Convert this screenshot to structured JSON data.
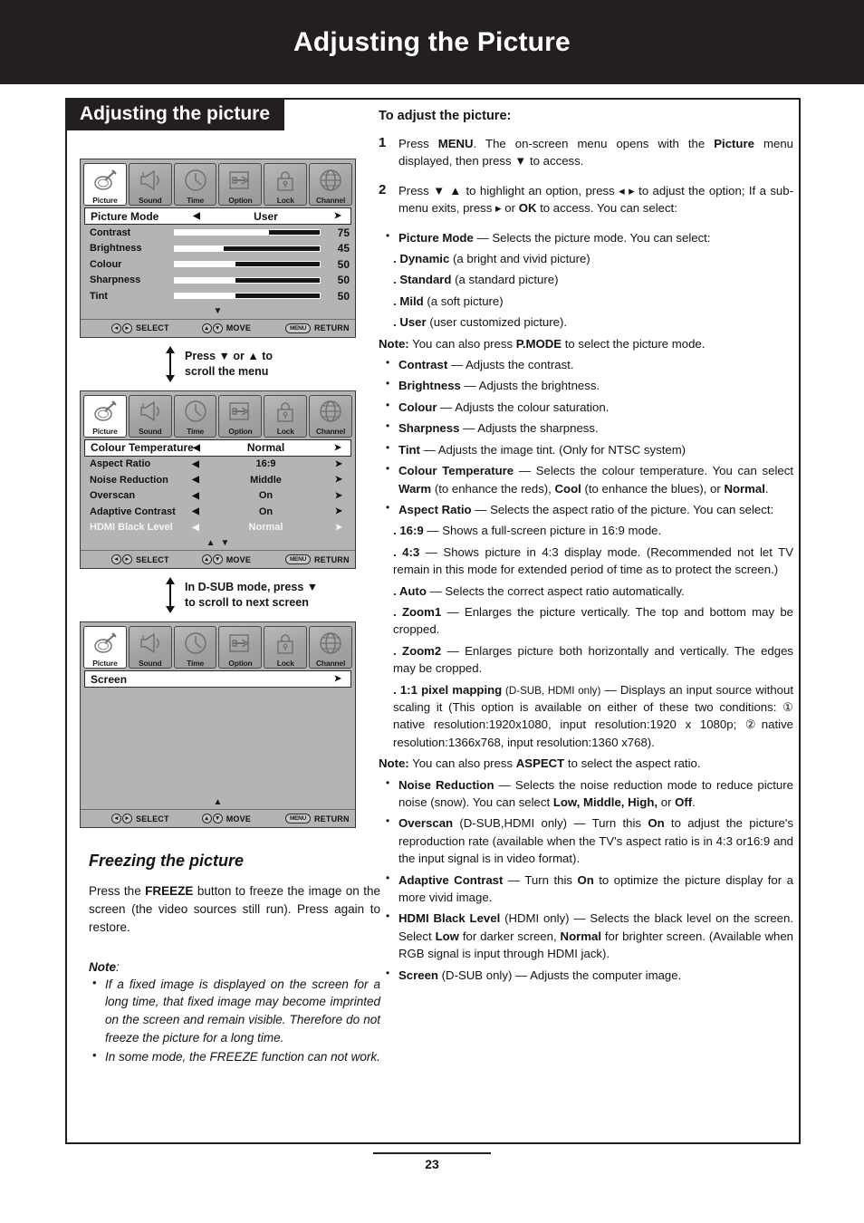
{
  "header": {
    "title": "Adjusting the Picture"
  },
  "section": {
    "tab_label": "Adjusting the picture"
  },
  "osd": {
    "tabs": [
      {
        "label": "Picture",
        "icon": "picture-icon",
        "active": true
      },
      {
        "label": "Sound",
        "icon": "speaker-icon",
        "active": false
      },
      {
        "label": "Time",
        "icon": "clock-icon",
        "active": false
      },
      {
        "label": "Option",
        "icon": "option-tool-icon",
        "active": false
      },
      {
        "label": "Lock",
        "icon": "padlock-icon",
        "active": false
      },
      {
        "label": "Channel",
        "icon": "globe-icon",
        "active": false
      }
    ],
    "footer": {
      "select": "SELECT",
      "move": "MOVE",
      "return": "RETURN",
      "menu_key": "MENU"
    },
    "panel1": {
      "highlight": {
        "label": "Picture Mode",
        "value": "User",
        "arrow_left": "◀",
        "arrow_right": "➤"
      },
      "sliders": [
        {
          "label": "Contrast",
          "value": "75",
          "fill_pct": 35
        },
        {
          "label": "Brightness",
          "value": "45",
          "fill_pct": 66
        },
        {
          "label": "Colour",
          "value": "50",
          "fill_pct": 58
        },
        {
          "label": "Sharpness",
          "value": "50",
          "fill_pct": 58
        },
        {
          "label": "Tint",
          "value": "50",
          "fill_pct": 58
        }
      ],
      "scroll_hint": "▼"
    },
    "panel2": {
      "highlight": {
        "label": "Colour Temperature",
        "value": "Normal"
      },
      "rows": [
        {
          "label": "Aspect Ratio",
          "value": "16:9",
          "dim": false
        },
        {
          "label": "Noise Reduction",
          "value": "Middle",
          "dim": false
        },
        {
          "label": "Overscan",
          "value": "On",
          "dim": false
        },
        {
          "label": "Adaptive Contrast",
          "value": "On",
          "dim": false
        },
        {
          "label": "HDMI Black Level",
          "value": "Normal",
          "dim": true
        }
      ],
      "scroll_hint_up": "▲",
      "scroll_hint_down": "▼"
    },
    "panel3": {
      "highlight": {
        "label": "Screen",
        "value": "",
        "arrow_right": "➤"
      },
      "scroll_hint_up": "▲"
    }
  },
  "between1": {
    "line1": "Press ▼  or ▲ to",
    "line2": "scroll the menu"
  },
  "between2": {
    "line1": "In D-SUB mode, press ▼",
    "line2": "to scroll to next screen"
  },
  "freeze": {
    "title": "Freezing the picture",
    "para_1a": "Press the ",
    "para_1b": "FREEZE",
    "para_1c": " button to freeze the image on the screen (the video sources still run). Press again to restore.",
    "note_label": "Note",
    "note_colon": ":",
    "notes": [
      "If a fixed image is displayed on the screen for a long time, that fixed image may become imprinted on the screen and remain visible. Therefore do not freeze the picture for a long time.",
      "In some mode, the FREEZE function can not work."
    ]
  },
  "right": {
    "title": "To adjust the picture:",
    "steps": [
      {
        "num": "1",
        "parts": [
          {
            "t": "Press ",
            "b": false
          },
          {
            "t": "MENU",
            "b": true
          },
          {
            "t": ". The on-screen menu opens with the ",
            "b": false
          },
          {
            "t": "Picture",
            "b": true
          },
          {
            "t": " menu displayed, then press ▼ to access.",
            "b": false
          }
        ]
      },
      {
        "num": "2",
        "parts": [
          {
            "t": "Press ▼ ▲ to highlight an option, press ◂  ▸ to adjust the option; If a sub-menu exits, press ▸ or ",
            "b": false
          },
          {
            "t": "OK",
            "b": true
          },
          {
            "t": " to access. You can select:",
            "b": false
          }
        ]
      }
    ],
    "items": [
      {
        "type": "bullet",
        "parts": [
          {
            "t": "Picture Mode",
            "b": true
          },
          {
            "t": " — Selects the picture mode. You can select:",
            "b": false
          }
        ]
      },
      {
        "type": "sub",
        "parts": [
          {
            "t": "Dynamic",
            "b": true
          },
          {
            "t": " (a bright and vivid picture)",
            "b": false
          }
        ]
      },
      {
        "type": "sub",
        "parts": [
          {
            "t": "Standard",
            "b": true
          },
          {
            "t": " (a standard picture)",
            "b": false
          }
        ]
      },
      {
        "type": "sub",
        "parts": [
          {
            "t": "Mild",
            "b": true
          },
          {
            "t": " (a soft picture)",
            "b": false
          }
        ]
      },
      {
        "type": "sub",
        "parts": [
          {
            "t": "User",
            "b": true
          },
          {
            "t": " (user customized picture).",
            "b": false
          }
        ]
      },
      {
        "type": "note",
        "parts": [
          {
            "t": "Note:",
            "b": true
          },
          {
            "t": " You can also press ",
            "b": false
          },
          {
            "t": "P.MODE",
            "b": true
          },
          {
            "t": " to select the picture mode.",
            "b": false
          }
        ]
      },
      {
        "type": "bullet",
        "parts": [
          {
            "t": "Contrast",
            "b": true
          },
          {
            "t": " — Adjusts the contrast.",
            "b": false
          }
        ]
      },
      {
        "type": "bullet",
        "parts": [
          {
            "t": "Brightness",
            "b": true
          },
          {
            "t": " — Adjusts the brightness.",
            "b": false
          }
        ]
      },
      {
        "type": "bullet",
        "parts": [
          {
            "t": "Colour",
            "b": true
          },
          {
            "t": " — Adjusts the colour saturation.",
            "b": false
          }
        ]
      },
      {
        "type": "bullet",
        "parts": [
          {
            "t": "Sharpness",
            "b": true
          },
          {
            "t": " — Adjusts the sharpness.",
            "b": false
          }
        ]
      },
      {
        "type": "bullet",
        "parts": [
          {
            "t": "Tint",
            "b": true
          },
          {
            "t": " — Adjusts the image tint. (Only for NTSC system)",
            "b": false
          }
        ]
      },
      {
        "type": "bullet",
        "parts": [
          {
            "t": " Colour Temperature",
            "b": true
          },
          {
            "t": " — Selects the colour temperature. You can select ",
            "b": false
          },
          {
            "t": "Warm",
            "b": true
          },
          {
            "t": " (to enhance the reds), ",
            "b": false
          },
          {
            "t": "Cool",
            "b": true
          },
          {
            "t": " (to enhance the blues), or ",
            "b": false
          },
          {
            "t": "Normal",
            "b": true
          },
          {
            "t": ".",
            "b": false
          }
        ]
      },
      {
        "type": "bullet",
        "parts": [
          {
            "t": " Aspect Ratio",
            "b": true
          },
          {
            "t": " — Selects the aspect ratio of the picture. You can select:",
            "b": false
          }
        ]
      },
      {
        "type": "sub",
        "parts": [
          {
            "t": "16:9",
            "b": true
          },
          {
            "t": " — Shows a full-screen picture in 16:9 mode.",
            "b": false
          }
        ]
      },
      {
        "type": "sub",
        "parts": [
          {
            "t": "4:3",
            "b": true
          },
          {
            "t": " — Shows picture in 4:3 display mode. (Recommended not let TV remain in this mode for extended period of time as to protect the screen.)",
            "b": false
          }
        ]
      },
      {
        "type": "sub",
        "parts": [
          {
            "t": "Auto",
            "b": true
          },
          {
            "t": " — Selects the correct aspect ratio automatically.",
            "b": false
          }
        ]
      },
      {
        "type": "sub",
        "parts": [
          {
            "t": "Zoom1",
            "b": true
          },
          {
            "t": " — Enlarges the picture vertically. The top and bottom may be cropped.",
            "b": false
          }
        ]
      },
      {
        "type": "sub",
        "parts": [
          {
            "t": "Zoom2",
            "b": true
          },
          {
            "t": " — Enlarges picture both horizontally and vertically. The edges may be cropped.",
            "b": false
          }
        ]
      },
      {
        "type": "sub",
        "parts": [
          {
            "t": "1:1 pixel mapping",
            "b": true
          },
          {
            "t": " (D-SUB, HDMI only)",
            "b": false,
            "small": true
          },
          {
            "t": " — Displays an input source without scaling it (This option is available on either of these two conditions:  ①  native resolution:1920x1080, input resolution:1920 x 1080p;   ②native resolution:1366x768, input resolution:1360 x768).",
            "b": false
          }
        ]
      },
      {
        "type": "note",
        "parts": [
          {
            "t": "Note:",
            "b": true
          },
          {
            "t": " You can also press ",
            "b": false
          },
          {
            "t": "ASPECT",
            "b": true
          },
          {
            "t": " to select the aspect ratio.",
            "b": false
          }
        ]
      },
      {
        "type": "bullet",
        "parts": [
          {
            "t": "Noise Reduction",
            "b": true
          },
          {
            "t": " — Selects the noise reduction mode to reduce picture noise (snow). You can select ",
            "b": false
          },
          {
            "t": "Low, Middle, High,",
            "b": true
          },
          {
            "t": " or ",
            "b": false
          },
          {
            "t": "Off",
            "b": true
          },
          {
            "t": ".",
            "b": false
          }
        ]
      },
      {
        "type": "bullet",
        "parts": [
          {
            "t": " Overscan",
            "b": true
          },
          {
            "t": " (D-SUB,HDMI only) —  Turn this ",
            "b": false
          },
          {
            "t": "On",
            "b": true
          },
          {
            "t": " to adjust the picture's reproduction rate (available when the TV's aspect ratio is in 4:3 or16:9 and the input signal is in video format).",
            "b": false
          }
        ]
      },
      {
        "type": "bullet",
        "parts": [
          {
            "t": " Adaptive Contrast",
            "b": true
          },
          {
            "t": " — Turn this ",
            "b": false
          },
          {
            "t": "On",
            "b": true
          },
          {
            "t": " to optimize the picture display for a more vivid image.",
            "b": false
          }
        ]
      },
      {
        "type": "bullet",
        "parts": [
          {
            "t": " HDMI Black Level",
            "b": true
          },
          {
            "t": " (HDMI only) — Selects the black level on the screen. Select ",
            "b": false
          },
          {
            "t": "Low",
            "b": true
          },
          {
            "t": " for darker screen, ",
            "b": false
          },
          {
            "t": "Normal",
            "b": true
          },
          {
            "t": " for brighter screen. (Available when RGB signal is input through HDMI jack).",
            "b": false
          }
        ]
      },
      {
        "type": "bullet",
        "parts": [
          {
            "t": " Screen",
            "b": true
          },
          {
            "t": " (D-SUB only) — Adjusts the computer image.",
            "b": false
          }
        ]
      }
    ]
  },
  "footer": {
    "page_number": "23"
  },
  "colors": {
    "header_bg": "#231f20",
    "osd_bg": "#b4b4b4",
    "osd_highlight": "#ffffff",
    "ink": "#141414"
  }
}
